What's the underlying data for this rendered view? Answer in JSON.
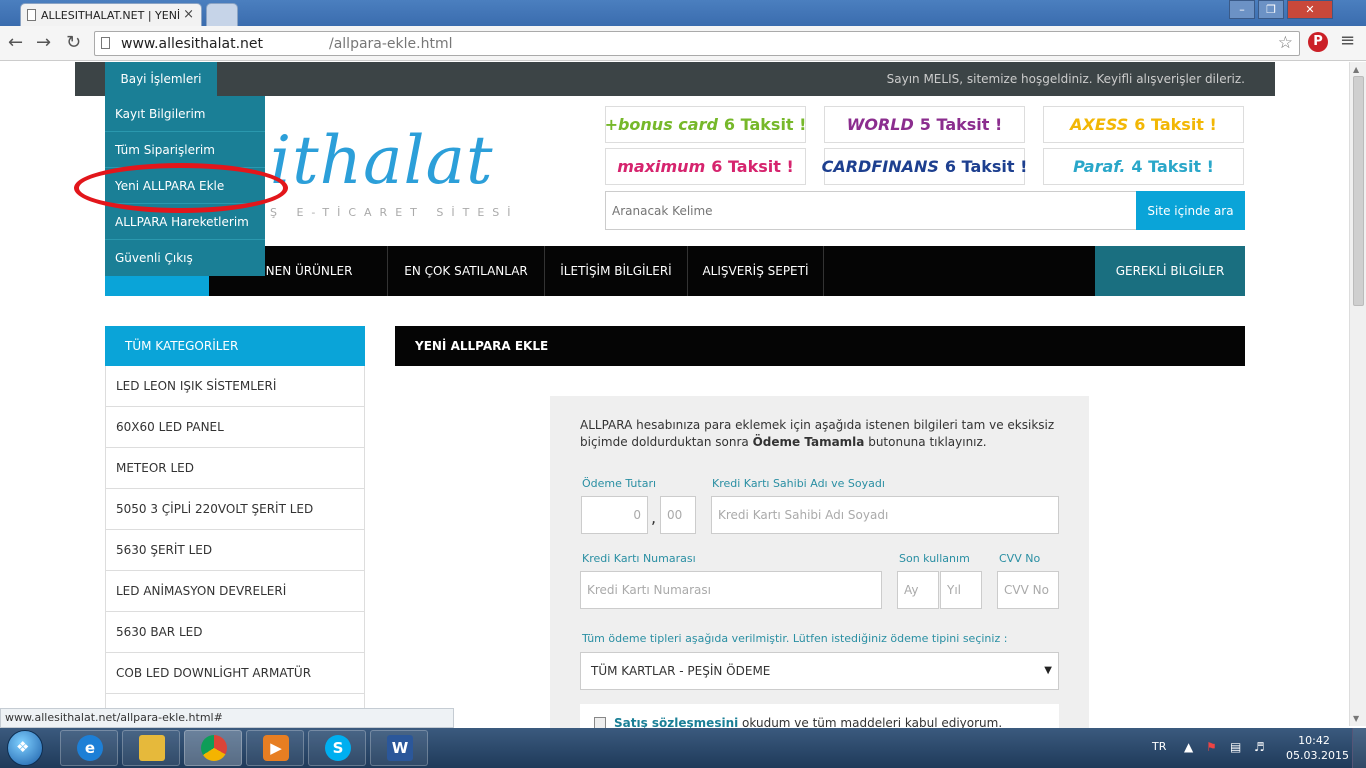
{
  "browser": {
    "tab_title": "ALLESITHALAT.NET | YENİ",
    "tab_close": "×",
    "url_host": "www.allesithalat.net",
    "url_path": "/allpara-ekle.html",
    "status_url": "www.allesithalat.net/allpara-ekle.html#"
  },
  "topbar": {
    "dealer_button": "Bayi İşlemleri",
    "welcome": "Sayın MELIS, sitemize hoşgeldiniz. Keyifli alışverişler dileriz."
  },
  "dropdown": {
    "items": [
      "Kayıt Bilgilerim",
      "Tüm Siparişlerim",
      "Yeni ALLPARA Ekle",
      "ALLPARA Hareketlerim",
      "Güvenli Çıkış"
    ]
  },
  "logo": {
    "text": "ithalat",
    "subtitle": "Ş E-TİCARET SİTESİ"
  },
  "cards": [
    {
      "brand": "+bonus card",
      "installment": "6 Taksit !",
      "color": "#76b82a"
    },
    {
      "brand": "WORLD",
      "installment": "5 Taksit !",
      "color": "#8b2d8e"
    },
    {
      "brand": "AXESS",
      "installment": "6 Taksit !",
      "color": "#f2b705"
    },
    {
      "brand": "maximum",
      "installment": "6 Taksit !",
      "color": "#d6246e"
    },
    {
      "brand": "CARDFINANS",
      "installment": "6 Taksit !",
      "color": "#1d3f8f"
    },
    {
      "brand": "Paraf.",
      "installment": "4 Taksit !",
      "color": "#2aa7c9"
    }
  ],
  "search": {
    "placeholder": "Aranacak Kelime",
    "button": "Site içinde ara"
  },
  "nav": {
    "items": [
      "KLENEN ÜRÜNLER",
      "EN ÇOK SATILANLAR",
      "İLETİŞİM BİLGİLERİ",
      "ALIŞVERİŞ SEPETİ"
    ],
    "right": "GEREKLİ BİLGİLER"
  },
  "categories": {
    "title": "TÜM KATEGORİLER",
    "items": [
      "LED LEON IŞIK SİSTEMLERİ",
      "60X60 LED PANEL",
      "METEOR LED",
      "5050 3 ÇİPLİ 220VOLT ŞERİT LED",
      "5630 ŞERİT LED",
      "LED ANİMASYON DEVRELERİ",
      "5630 BAR LED",
      "COB LED DOWNLİGHT ARMATÜR"
    ]
  },
  "content": {
    "title": "YENİ ALLPARA EKLE",
    "intro_part1": "ALLPARA hesabınıza para eklemek için aşağıda istenen bilgileri tam ve eksiksiz biçimde doldurduktan sonra ",
    "intro_bold": "Ödeme Tamamla",
    "intro_part2": " butonuna tıklayınız.",
    "form": {
      "amount_label": "Ödeme Tutarı",
      "amount_whole": "0",
      "amount_cents": "00",
      "comma": ",",
      "holder_label": "Kredi Kartı Sahibi Adı ve Soyadı",
      "holder_placeholder": "Kredi Kartı Sahibi Adı Soyadı",
      "card_label": "Kredi Kartı Numarası",
      "card_placeholder": "Kredi Kartı Numarası",
      "expiry_label": "Son kullanım",
      "month_placeholder": "Ay",
      "year_placeholder": "Yıl",
      "cvv_label": "CVV No",
      "cvv_placeholder": "CVV No",
      "payment_info": "Tüm ödeme tipleri aşağıda verilmiştir. Lütfen istediğiniz ödeme tipini seçiniz :",
      "payment_selected": "TÜM KARTLAR - PEŞİN ÖDEME",
      "agree_link": "Satış sözleşmesini",
      "agree_text": " okudum ve tüm maddeleri kabul ediyorum."
    }
  },
  "taskbar": {
    "language": "TR",
    "time": "10:42",
    "date": "05.03.2015"
  }
}
